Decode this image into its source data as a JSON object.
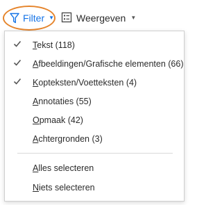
{
  "toolbar": {
    "filter_button": {
      "label": "Filter",
      "accent": "#1473e6",
      "icon": "filter-funnel-icon"
    },
    "view_button": {
      "label": "Weergeven",
      "icon": "view-list-icon"
    },
    "highlight_color": "#e5842b"
  },
  "menu": {
    "items": [
      {
        "key": "T",
        "rest": "ekst (118)",
        "checked": true
      },
      {
        "key": "A",
        "rest": "fbeeldingen/Grafische elementen (66)",
        "checked": true
      },
      {
        "key": "K",
        "rest": "opteksten/Voetteksten (4)",
        "checked": true
      },
      {
        "key": "A",
        "rest": "nnotaties (55)",
        "checked": false
      },
      {
        "key": "O",
        "rest": "pmaak (42)",
        "checked": false
      },
      {
        "key": "A",
        "rest": "chtergronden (3)",
        "checked": false
      }
    ],
    "actions": [
      {
        "key": "A",
        "rest": "lles selecteren"
      },
      {
        "key": "N",
        "rest": "iets selecteren"
      }
    ]
  }
}
